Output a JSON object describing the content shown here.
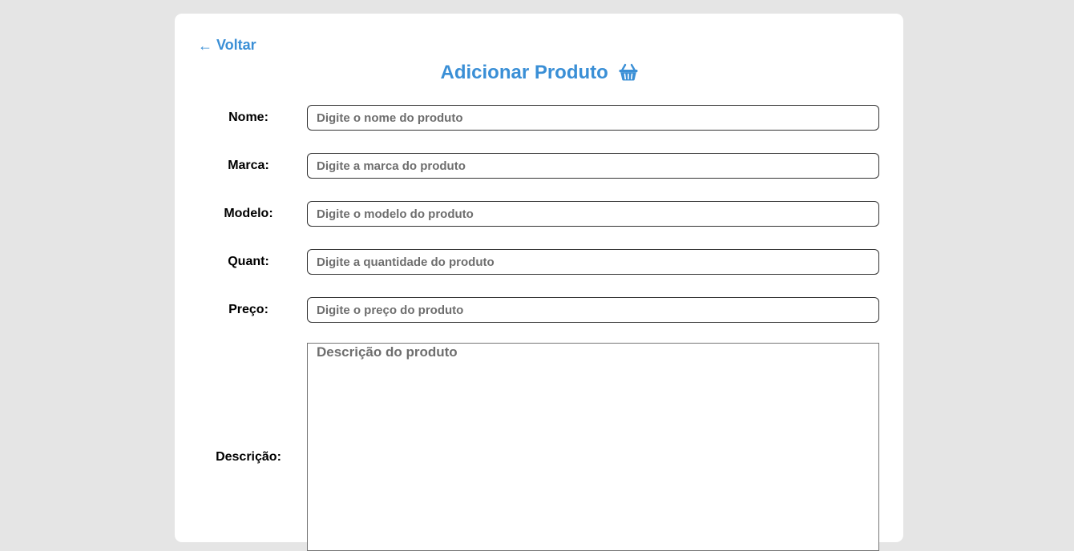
{
  "header": {
    "back_label": "Voltar",
    "back_icon": "arrow-left-icon",
    "title": "Adicionar Produto",
    "title_icon": "basket-icon",
    "accent_color": "#3a8fd6"
  },
  "form": {
    "nome": {
      "label": "Nome:",
      "placeholder": "Digite o nome do produto"
    },
    "marca": {
      "label": "Marca:",
      "placeholder": "Digite a marca do produto"
    },
    "modelo": {
      "label": "Modelo:",
      "placeholder": "Digite o modelo do produto"
    },
    "quant": {
      "label": "Quant:",
      "placeholder": "Digite a quantidade do produto"
    },
    "preco": {
      "label": "Preço:",
      "placeholder": "Digite o preço do produto"
    },
    "descricao": {
      "label": "Descrição:",
      "placeholder": "Descrição do produto"
    }
  }
}
